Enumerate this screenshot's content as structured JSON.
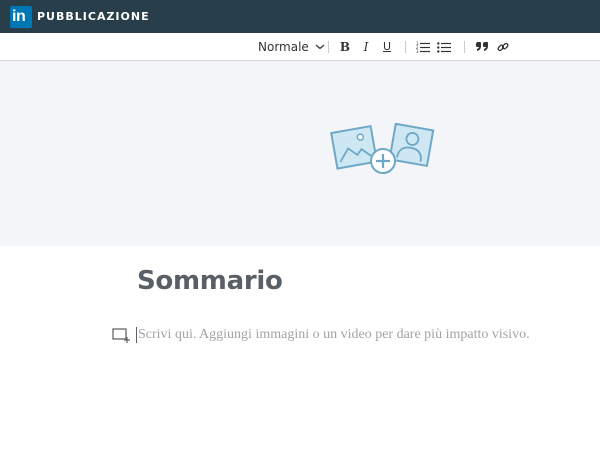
{
  "header": {
    "logo_text": "in",
    "section_title": "PUBBLICAZIONE",
    "colors": {
      "bar": "#283e4a",
      "logo": "#0077b5"
    }
  },
  "toolbar": {
    "style_label": "Normale",
    "bold_label": "B",
    "italic_label": "I",
    "underline_label": "U",
    "icons": [
      "chevron-down-icon",
      "numbered-list-icon",
      "bulleted-list-icon",
      "quote-icon",
      "link-icon"
    ]
  },
  "cover": {
    "icon": "add-image-icon",
    "colors": {
      "background": "#f3f5f8",
      "icon": "#6fa8c7",
      "icon_fill": "#cde7f3"
    }
  },
  "article": {
    "title": "Sommario",
    "body_placeholder": "Scrivi qui. Aggiungi immagini o un video per dare più impatto visivo."
  }
}
